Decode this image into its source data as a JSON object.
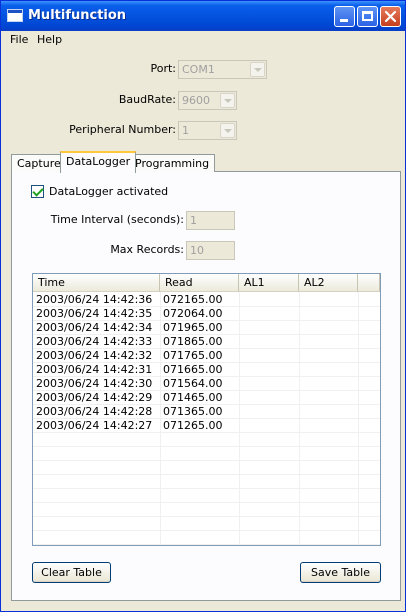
{
  "window": {
    "title": "Multifunction"
  },
  "menu": {
    "file": "File",
    "help": "Help"
  },
  "settings": {
    "port_label": "Port:",
    "port_value": "COM1",
    "baudrate_label": "BaudRate:",
    "baudrate_value": "9600",
    "peripheral_label": "Peripheral Number:",
    "peripheral_value": "1"
  },
  "tabs": [
    {
      "label": "Capture",
      "active": false
    },
    {
      "label": "DataLogger",
      "active": true
    },
    {
      "label": "Programming",
      "active": false
    }
  ],
  "datalogger": {
    "activated_label": "DataLogger activated",
    "activated": true,
    "interval_label": "Time Interval (seconds):",
    "interval_value": "1",
    "max_records_label": "Max Records:",
    "max_records_value": "10"
  },
  "table": {
    "columns": [
      "Time",
      "Read",
      "AL1",
      "AL2"
    ],
    "rows": [
      [
        "2003/06/24 14:42:36",
        "072165.00",
        "",
        ""
      ],
      [
        "2003/06/24 14:42:35",
        "072064.00",
        "",
        ""
      ],
      [
        "2003/06/24 14:42:34",
        "071965.00",
        "",
        ""
      ],
      [
        "2003/06/24 14:42:33",
        "071865.00",
        "",
        ""
      ],
      [
        "2003/06/24 14:42:32",
        "071765.00",
        "",
        ""
      ],
      [
        "2003/06/24 14:42:31",
        "071665.00",
        "",
        ""
      ],
      [
        "2003/06/24 14:42:30",
        "071564.00",
        "",
        ""
      ],
      [
        "2003/06/24 14:42:29",
        "071465.00",
        "",
        ""
      ],
      [
        "2003/06/24 14:42:28",
        "071365.00",
        "",
        ""
      ],
      [
        "2003/06/24 14:42:27",
        "071265.00",
        "",
        ""
      ]
    ]
  },
  "buttons": {
    "clear": "Clear Table",
    "save": "Save Table"
  }
}
